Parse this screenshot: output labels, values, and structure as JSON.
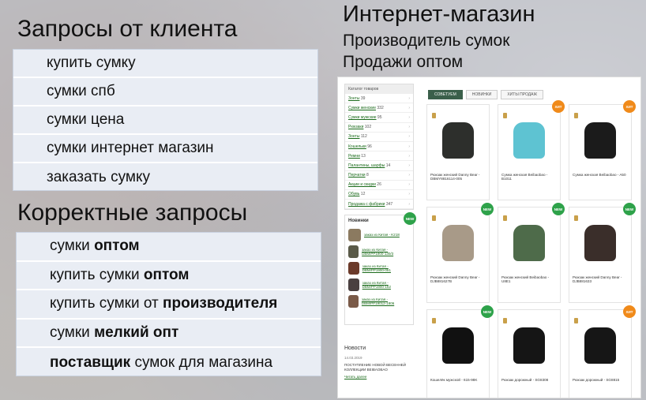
{
  "headings": {
    "client_queries": "Запросы от клиента",
    "correct_queries": "Корректные запросы",
    "shop_title": "Интернет-магазин",
    "shop_sub1": "Производитель сумок",
    "shop_sub2": "Продажи оптом"
  },
  "client_queries": [
    "купить сумку",
    "сумки спб",
    "сумки цена",
    "сумки интернет магазин",
    "заказать сумку"
  ],
  "correct_queries": [
    {
      "pre": "сумки ",
      "bold": "оптом",
      "post": ""
    },
    {
      "pre": "купить сумки ",
      "bold": "оптом",
      "post": ""
    },
    {
      "pre": "купить сумки от ",
      "bold": "производителя",
      "post": ""
    },
    {
      "pre": "сумки ",
      "bold": "мелкий опт",
      "post": ""
    },
    {
      "pre": "",
      "bold": "поставщик",
      "post": " сумок для магазина"
    }
  ],
  "shop": {
    "catalog_title": "Каталог товаров",
    "categories": [
      {
        "name": "Зонты",
        "count": "39",
        "sub": "39"
      },
      {
        "name": "Сумки женские",
        "count": "332",
        "sub": ""
      },
      {
        "name": "Сумки мужские",
        "count": "95",
        "sub": ""
      },
      {
        "name": "Рюкзаки",
        "count": "102",
        "sub": ""
      },
      {
        "name": "Зонты",
        "count": "112",
        "sub": ""
      },
      {
        "name": "Кошельки",
        "count": "96",
        "sub": ""
      },
      {
        "name": "Ремни",
        "count": "13",
        "sub": ""
      },
      {
        "name": "Палантины, шарфы",
        "count": "14",
        "sub": ""
      },
      {
        "name": "Перчатки",
        "count": "8",
        "sub": ""
      },
      {
        "name": "Акции и скидки",
        "count": "26",
        "sub": ""
      },
      {
        "name": "Обувь",
        "count": "12",
        "sub": ""
      },
      {
        "name": "Продажа с фабрики",
        "count": "347",
        "sub": ""
      }
    ],
    "new_title": "Новинки",
    "new_badge": "NEW",
    "new_items": [
      "заказ из Китая - K218",
      "заказ из Китая - DBM/PP1900-130/3",
      "заказ из Китая - DBM/PP1900-051",
      "заказ из Китая - DBM/PP1900-152",
      "заказ из Китая - DBM/PP19012-1806"
    ],
    "tabs": [
      "СОВЕТУЕМ",
      "НОВИНКИ",
      "ХИТЫ ПРОДАЖ"
    ],
    "products": [
      {
        "name": "Рюкзак женский Danny Bear - DBMY8816114-005",
        "badge": "",
        "color": "#2d2f2c"
      },
      {
        "name": "Сумка женская Beibaobao - B1011",
        "badge": "ХИТ",
        "color": "#5ec3d2"
      },
      {
        "name": "Сумка женская Beibaobao - A50",
        "badge": "ХИТ",
        "color": "#1b1b1b"
      },
      {
        "name": "Рюкзак женский Danny Bear - DJB881627B",
        "badge": "NEW",
        "color": "#a89a88"
      },
      {
        "name": "Рюкзак женский Beibaobao - U8E1",
        "badge": "NEW",
        "color": "#4e6b4a"
      },
      {
        "name": "Рюкзак женский Danny Bear - DJB881633",
        "badge": "NEW",
        "color": "#3a2e2a"
      },
      {
        "name": "Кошелёк мужской - 615-98K",
        "badge": "NEW",
        "color": "#111111"
      },
      {
        "name": "Рюкзак дорожный - SG8308",
        "badge": "",
        "color": "#151515"
      },
      {
        "name": "Рюкзак дорожный - SG8815",
        "badge": "ХИТ",
        "color": "#161616"
      }
    ],
    "news_title": "Новости",
    "news_date": "14.03.2019",
    "news_text": "ПОСТУПЛЕНИЕ НОВОЙ ВЕСЕННЕЙ КОЛЛЕКЦИИ BEIBAOBAO",
    "news_more": "Читать далее"
  },
  "colors": {
    "new_badge": "#2ea24a",
    "hit_badge": "#f08a1a"
  }
}
